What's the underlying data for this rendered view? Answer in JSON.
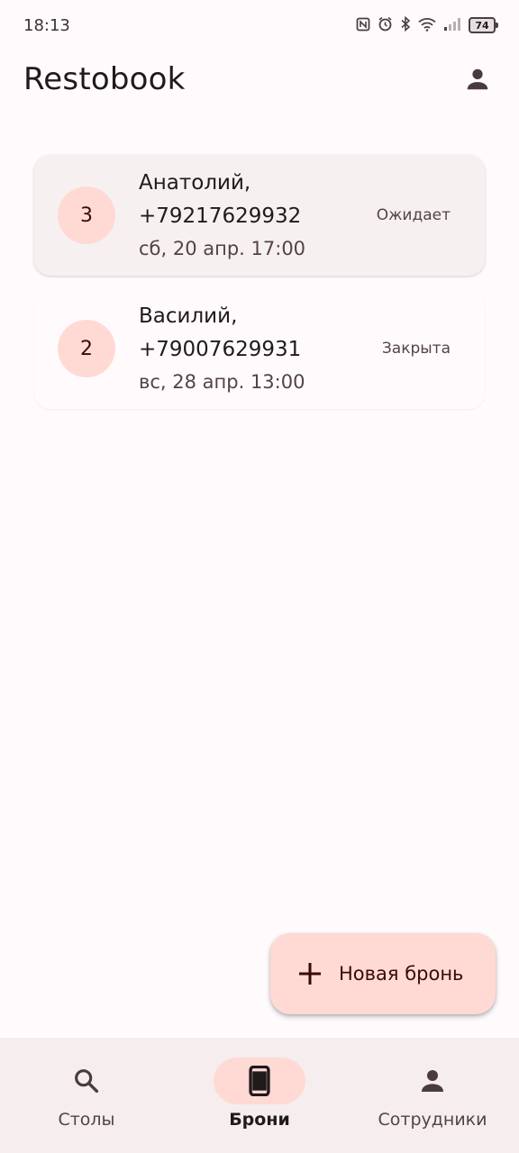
{
  "status_bar": {
    "time": "18:13",
    "icons": [
      "nfc-icon",
      "alarm-icon",
      "bluetooth-icon",
      "wifi-icon",
      "signal-icon"
    ],
    "battery": "74"
  },
  "app_bar": {
    "title": "Restobook",
    "account_icon": "person-icon"
  },
  "bookings": [
    {
      "guests": "3",
      "name": "Анатолий,",
      "phone": "+79217629932",
      "datetime": "сб, 20 апр. 17:00",
      "status": "Ожидает"
    },
    {
      "guests": "2",
      "name": "Василий,",
      "phone": "+79007629931",
      "datetime": "вс, 28 апр. 13:00",
      "status": "Закрыта"
    }
  ],
  "fab": {
    "icon": "plus-icon",
    "label": "Новая бронь"
  },
  "bottom_nav": {
    "items": [
      {
        "label": "Столы",
        "icon": "search-icon",
        "active": false
      },
      {
        "label": "Брони",
        "icon": "phone-icon",
        "active": true
      },
      {
        "label": "Сотрудники",
        "icon": "person-icon",
        "active": false
      }
    ]
  },
  "colors": {
    "background": "#fffbfc",
    "badge": "#ffdad5",
    "nav_background": "#f6edee",
    "on_container": "#3b0908"
  }
}
